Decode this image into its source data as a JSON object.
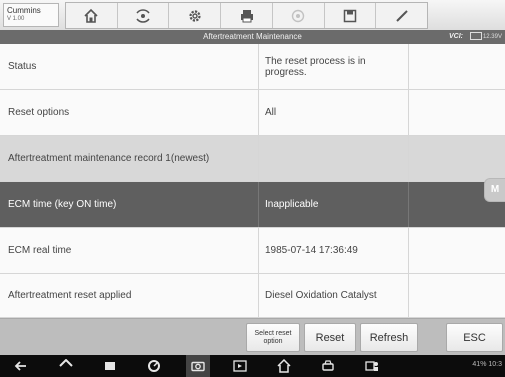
{
  "vehicle": {
    "name": "Cummins",
    "version": "V 1.00"
  },
  "toolbar": {
    "tools": [
      {
        "name": "home-icon"
      },
      {
        "name": "vehicle-swap-icon"
      },
      {
        "name": "settings-icon"
      },
      {
        "name": "print-icon"
      },
      {
        "name": "help-icon"
      },
      {
        "name": "save-icon"
      },
      {
        "name": "data-log-icon"
      }
    ]
  },
  "titlebar": {
    "title": "Aftertreatment Maintenance",
    "vci": "VCI:",
    "battery": "12.39V"
  },
  "table": {
    "rows": [
      {
        "label": "Status",
        "value": "The reset process is in progress.",
        "type": "normal"
      },
      {
        "label": "Reset options",
        "value": "All",
        "type": "normal"
      },
      {
        "label": "Aftertreatment maintenance record 1(newest)",
        "value": "",
        "type": "header"
      },
      {
        "label": "ECM time (key ON time)",
        "value": "Inapplicable",
        "type": "selected"
      },
      {
        "label": "ECM real time",
        "value": "1985-07-14 17:36:49",
        "type": "normal"
      },
      {
        "label": "Aftertreatment reset applied",
        "value": "Diesel Oxidation Catalyst",
        "type": "normal"
      }
    ]
  },
  "side_tab": {
    "label": "M"
  },
  "actions": {
    "select_reset_option": "Select reset option",
    "reset": "Reset",
    "refresh": "Refresh",
    "esc": "ESC"
  },
  "navbar": {
    "status": "41% 10:3"
  }
}
